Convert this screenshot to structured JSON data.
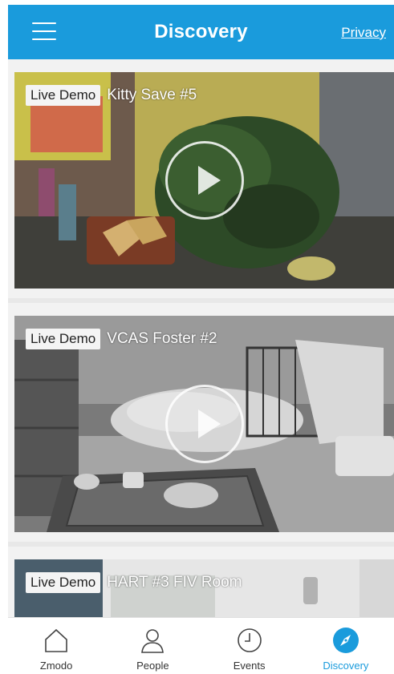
{
  "header": {
    "title": "Discovery",
    "privacy_label": "Privacy"
  },
  "feed": [
    {
      "badge": "Live Demo",
      "name": "Kitty Save #5"
    },
    {
      "badge": "Live Demo",
      "name": "VCAS Foster #2"
    },
    {
      "badge": "Live Demo",
      "name": "HART #3 FIV Room"
    }
  ],
  "tabs": [
    {
      "label": "Zmodo",
      "icon": "home-icon"
    },
    {
      "label": "People",
      "icon": "person-icon"
    },
    {
      "label": "Events",
      "icon": "clock-icon"
    },
    {
      "label": "Discovery",
      "icon": "compass-icon",
      "active": true
    }
  ],
  "colors": {
    "accent": "#1a9bdc",
    "header_bg": "#1a9bdc"
  }
}
